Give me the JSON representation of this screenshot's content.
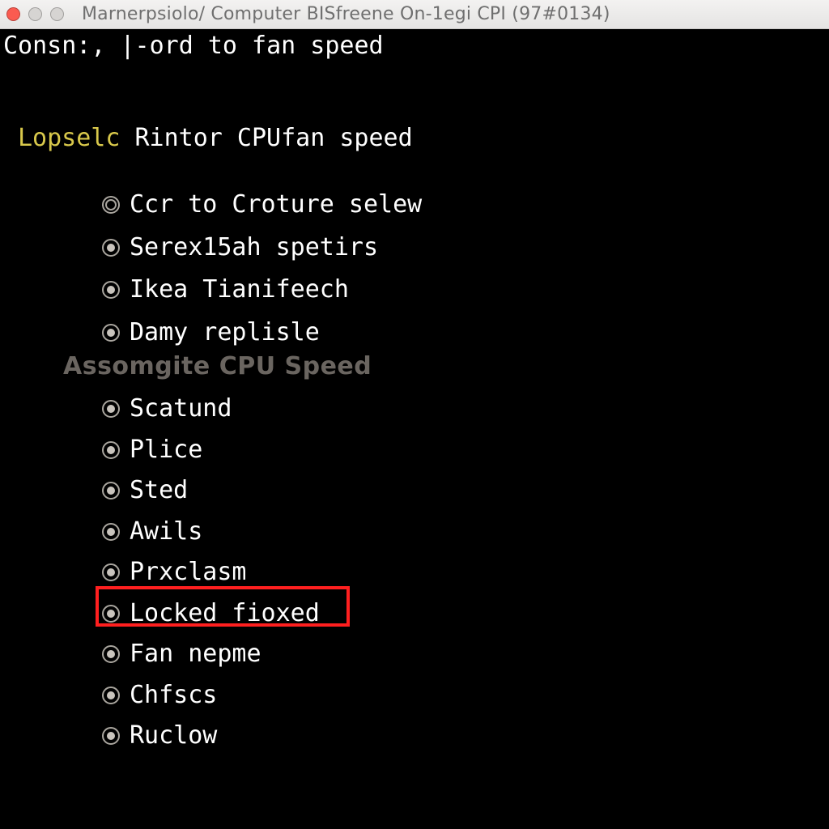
{
  "window": {
    "title": "Marnerpsiolo/ Computer BISfreene On-1egi CPI (97#0134)"
  },
  "console_top_line": "Consn:, |-ord to fan speed",
  "section_header": {
    "prefix": "Lopselc",
    "rest": " Rintor CPUfan speed"
  },
  "group1": [
    "Ccr to Croture selew",
    "Serex15ah spetirs",
    "Ikea Tianifeech",
    "Damy replisle"
  ],
  "sub_header": "Assomgite CPU Speed",
  "group2": [
    "Scatund",
    "Plice",
    "Sted",
    "Awils",
    "Prxclasm",
    "Locked fioxed",
    "Fan nepme",
    "Chfscs",
    "Ruclow"
  ],
  "highlighted_index": 5
}
